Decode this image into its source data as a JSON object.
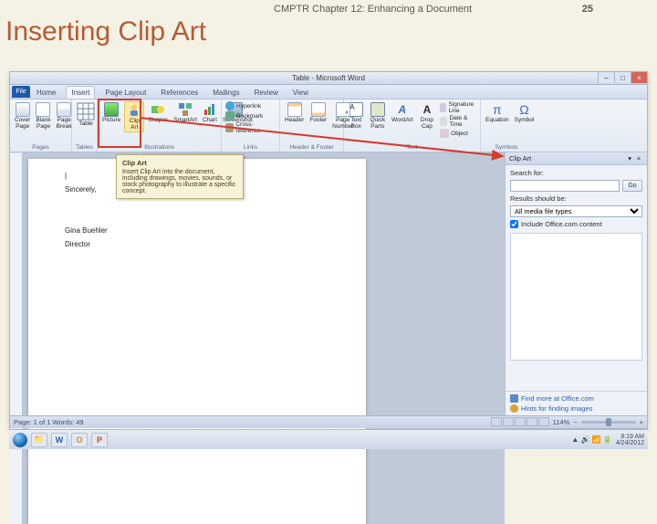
{
  "slide": {
    "chapter": "CMPTR Chapter 12: Enhancing a Document",
    "page": "25",
    "title": "Inserting Clip Art"
  },
  "window": {
    "title": "Table - Microsoft Word",
    "buttons": {
      "min": "–",
      "max": "□",
      "close": "×"
    }
  },
  "file_tab": "File",
  "tabs": [
    "Home",
    "Insert",
    "Page Layout",
    "References",
    "Mailings",
    "Review",
    "View"
  ],
  "active_tab_index": 1,
  "ribbon": {
    "pages": {
      "label": "Pages",
      "items": [
        "Cover Page",
        "Blank Page",
        "Page Break"
      ]
    },
    "tables": {
      "label": "Tables",
      "items": [
        "Table"
      ]
    },
    "illus": {
      "label": "Illustrations",
      "items": [
        "Picture",
        "Clip Art",
        "Shapes",
        "SmartArt",
        "Chart",
        "Screenshot"
      ]
    },
    "links": {
      "label": "Links",
      "items": [
        "Hyperlink",
        "Bookmark",
        "Cross-reference"
      ]
    },
    "hf": {
      "label": "Header & Footer",
      "items": [
        "Header",
        "Footer",
        "Page Number"
      ]
    },
    "text": {
      "label": "Text",
      "items": [
        "Text Box",
        "Quick Parts",
        "WordArt",
        "Drop Cap",
        "Signature Line",
        "Date & Time",
        "Object"
      ]
    },
    "symbols": {
      "label": "Symbols",
      "items": [
        "Equation",
        "Symbol"
      ]
    }
  },
  "tooltip": {
    "title": "Clip Art",
    "body": "Insert Clip Art into the document, including drawings, movies, sounds, or stock photography to illustrate a specific concept."
  },
  "document": {
    "lines": [
      "Sincerely,",
      "Gina Buehler",
      "Director"
    ]
  },
  "pane": {
    "title": "Clip Art",
    "search_label": "Search for:",
    "search_value": "",
    "go": "Go",
    "results_label": "Results should be:",
    "results_value": "All media file types",
    "include_label": "Include Office.com content",
    "include_checked": true,
    "footer1": "Find more at Office.com",
    "footer2": "Hints for finding images"
  },
  "status": {
    "left": "Page: 1 of 1    Words: 49",
    "zoom": "114%"
  },
  "taskbar": {
    "time": "8:19 AM",
    "date": "4/24/2012"
  }
}
